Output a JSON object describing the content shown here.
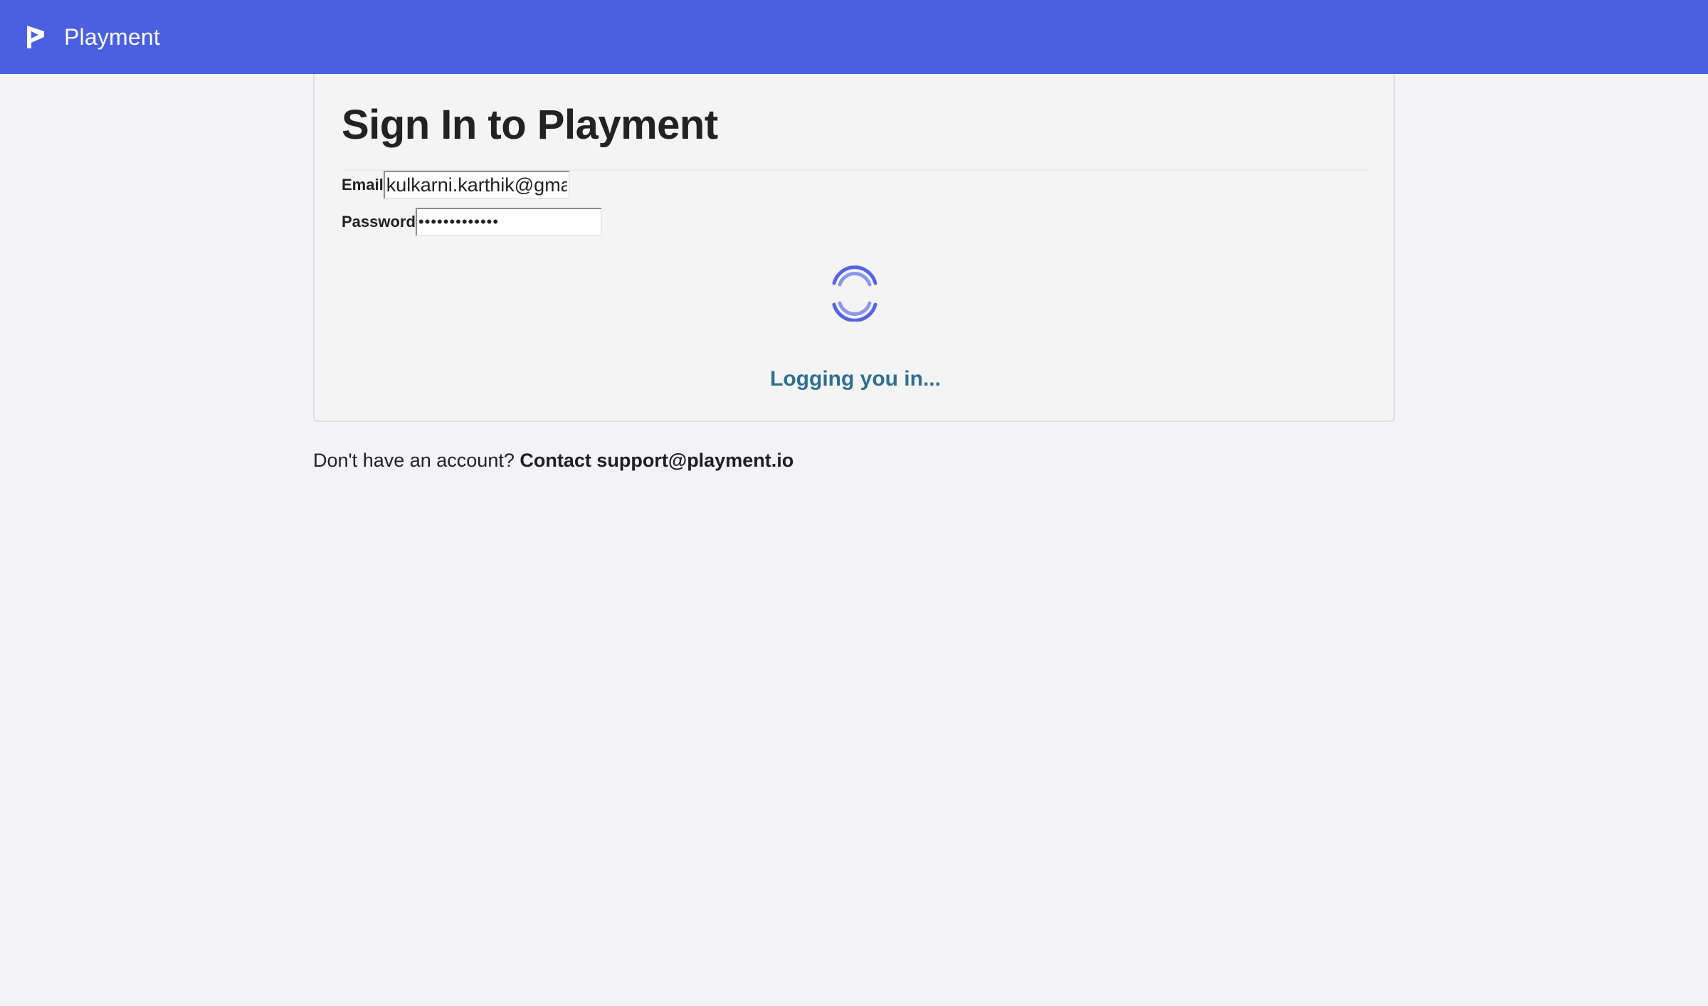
{
  "header": {
    "brand_name": "Playment",
    "logo_icon": "playment-logo-icon",
    "background_color": "#4b60e0"
  },
  "signin": {
    "title": "Sign In to Playment",
    "email_label": "Email",
    "email_value": "kulkarni.karthik@gma",
    "password_label": "Password",
    "password_value": "•••••••••••••",
    "loading_icon": "loading-spinner-icon",
    "status_text": "Logging you in...",
    "status_color": "#2f6f8f",
    "spinner_color": "#5564e0"
  },
  "footer": {
    "prompt": "Don't have an account?",
    "contact_link": "Contact support@playment.io"
  }
}
